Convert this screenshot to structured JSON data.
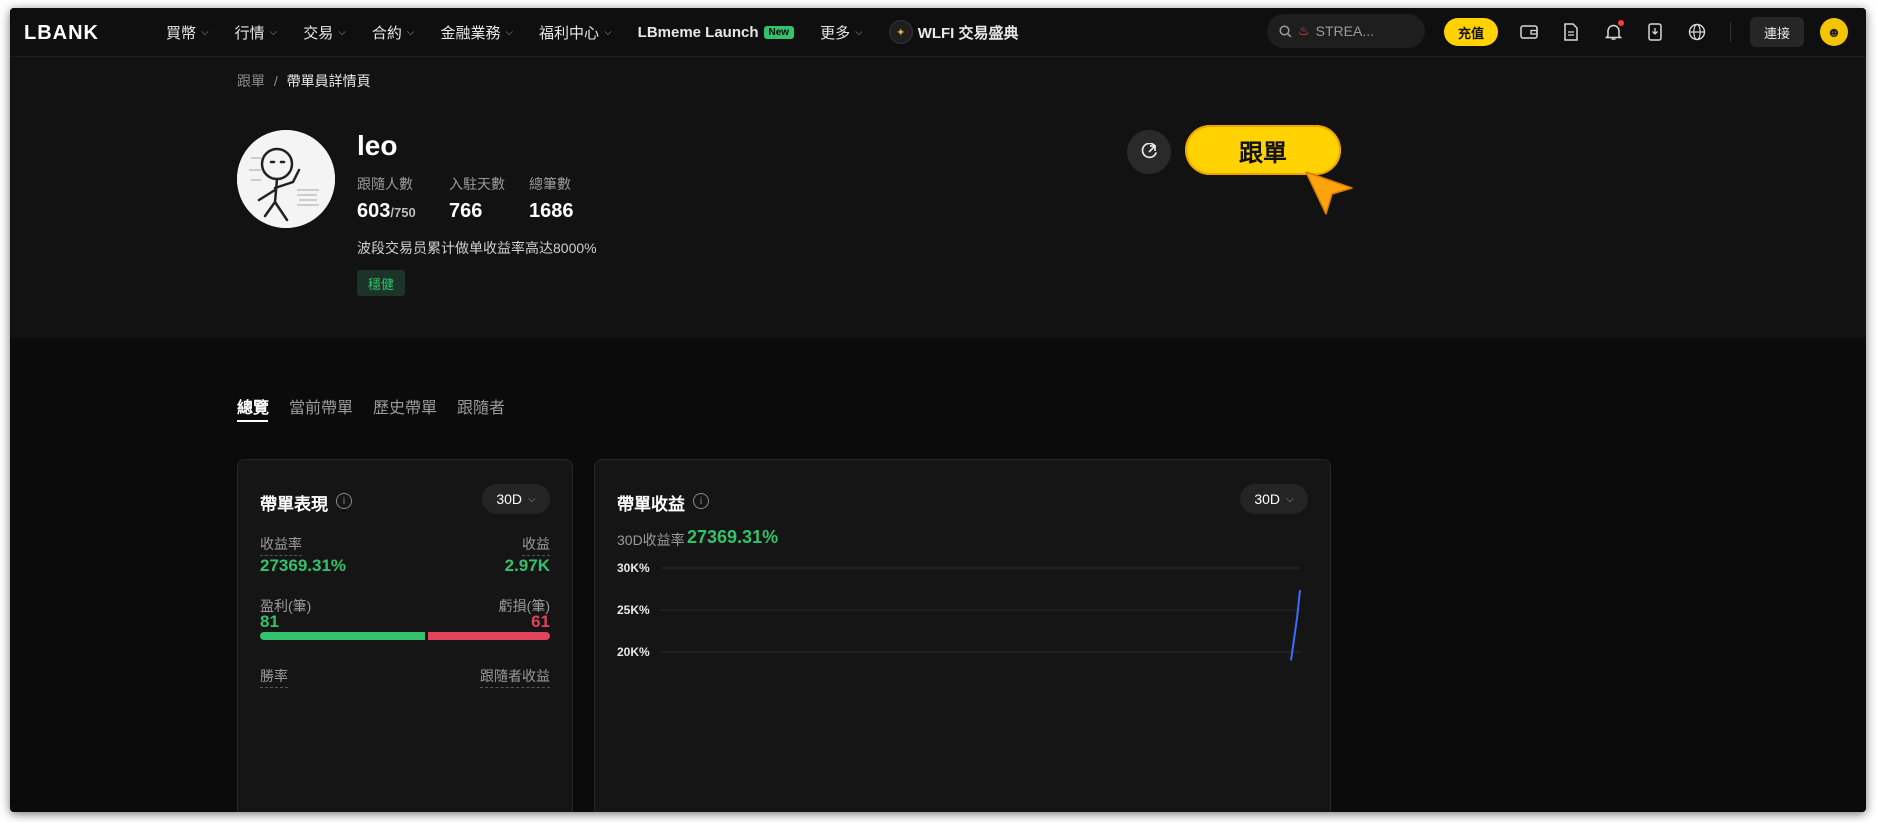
{
  "header": {
    "logo": "LBANK",
    "nav": [
      {
        "label": "買幣"
      },
      {
        "label": "行情"
      },
      {
        "label": "交易"
      },
      {
        "label": "合約"
      },
      {
        "label": "金融業務"
      },
      {
        "label": "福利中心"
      },
      {
        "label": "LBmeme Launch",
        "badge": "New"
      },
      {
        "label": "更多"
      },
      {
        "label": "WLFI 交易盛典"
      }
    ],
    "search_placeholder": "STREA...",
    "deposit": "充值",
    "connect": "連接"
  },
  "breadcrumb": {
    "root": "跟單",
    "sep": "/",
    "current": "帶單員詳情頁"
  },
  "profile": {
    "name": "leo",
    "stats": [
      {
        "label": "跟隨人數",
        "value": "603",
        "sub": "/750"
      },
      {
        "label": "入駐天數",
        "value": "766",
        "sub": ""
      },
      {
        "label": "總筆數",
        "value": "1686",
        "sub": ""
      }
    ],
    "bio": "波段交易员累计做单收益率高达8000%",
    "tag": "穩健",
    "follow": "跟單"
  },
  "tabs": [
    "總覽",
    "當前帶單",
    "歷史帶單",
    "跟隨者"
  ],
  "performance": {
    "title": "帶單表現",
    "period": "30D",
    "roi_label": "收益率",
    "roi_value": "27369.31%",
    "pnl_label": "收益",
    "pnl_value": "2.97K",
    "win_label": "盈利(筆)",
    "win_value": "81",
    "loss_label": "虧損(筆)",
    "loss_value": "61",
    "win_fraction": 0.57,
    "winrate_label": "勝率",
    "follower_pnl_label": "跟隨者收益"
  },
  "earnings": {
    "title": "帶單收益",
    "period": "30D",
    "roi_label": "30D收益率",
    "roi_value": "27369.31%"
  },
  "chart_data": {
    "type": "line",
    "title": "",
    "ylabel": "",
    "y_ticks": [
      "30K%",
      "25K%",
      "20K%"
    ],
    "ylim_visible": [
      18000,
      30000
    ],
    "series": [
      {
        "values": [
          19000,
          21500,
          24000,
          27369.31
        ]
      }
    ],
    "grid": true,
    "colors": {
      "line": "#3d6bff",
      "grid": "#2a2a2a"
    }
  },
  "colors": {
    "accent": "#ffd200",
    "up": "#33c26b",
    "down": "#e0435b"
  }
}
